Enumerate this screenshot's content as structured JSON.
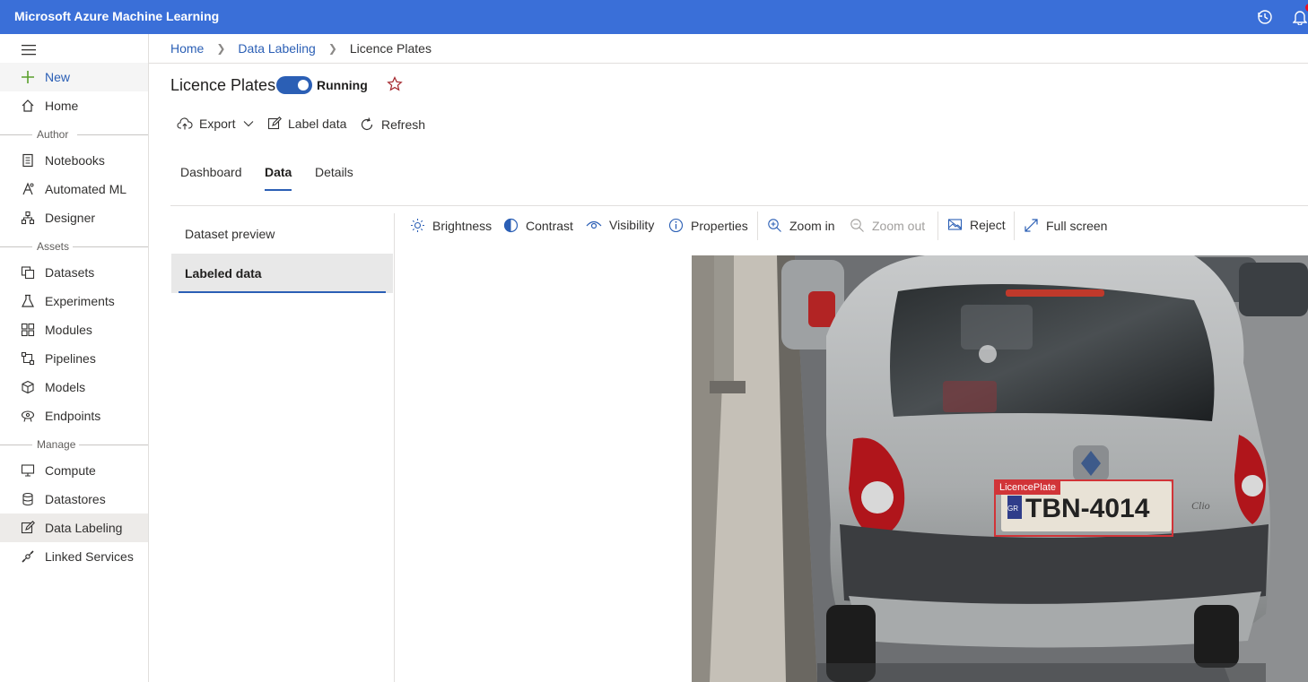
{
  "app": {
    "title": "Microsoft Azure Machine Learning"
  },
  "sidebar": {
    "new_label": "New",
    "home_label": "Home",
    "sections": {
      "author": "Author",
      "assets": "Assets",
      "manage": "Manage"
    },
    "items": [
      {
        "label": "Notebooks",
        "icon": "notebook-icon"
      },
      {
        "label": "Automated ML",
        "icon": "automated-ml-icon"
      },
      {
        "label": "Designer",
        "icon": "designer-icon"
      },
      {
        "label": "Datasets",
        "icon": "datasets-icon"
      },
      {
        "label": "Experiments",
        "icon": "flask-icon"
      },
      {
        "label": "Modules",
        "icon": "modules-icon"
      },
      {
        "label": "Pipelines",
        "icon": "pipelines-icon"
      },
      {
        "label": "Models",
        "icon": "cube-icon"
      },
      {
        "label": "Endpoints",
        "icon": "endpoints-icon"
      },
      {
        "label": "Compute",
        "icon": "monitor-icon"
      },
      {
        "label": "Datastores",
        "icon": "database-icon"
      },
      {
        "label": "Data Labeling",
        "icon": "edit-icon",
        "active": true
      },
      {
        "label": "Linked Services",
        "icon": "linked-services-icon"
      }
    ]
  },
  "breadcrumb": {
    "home": "Home",
    "data_labeling": "Data Labeling",
    "current": "Licence Plates"
  },
  "page": {
    "title": "Licence Plates",
    "toggle_label": "Running"
  },
  "commands": {
    "export": "Export",
    "label_data": "Label data",
    "refresh": "Refresh"
  },
  "tabs": {
    "dashboard": "Dashboard",
    "data": "Data",
    "details": "Details",
    "active": "Data"
  },
  "subnav": {
    "dataset_preview": "Dataset preview",
    "labeled_data": "Labeled data",
    "active": "Labeled data"
  },
  "image_toolbar": {
    "brightness": "Brightness",
    "contrast": "Contrast",
    "visibility": "Visibility",
    "properties": "Properties",
    "zoom_in": "Zoom in",
    "zoom_out": "Zoom out",
    "reject": "Reject",
    "full_screen": "Full screen"
  },
  "annotation": {
    "label": "LicencePlate",
    "plate_text": "TBN-4014",
    "plate_country": "GR",
    "car_badge": "Clio"
  },
  "colors": {
    "topbar": "#3a6fd8",
    "accent": "#2b5fb5",
    "bbox": "#d13438"
  }
}
